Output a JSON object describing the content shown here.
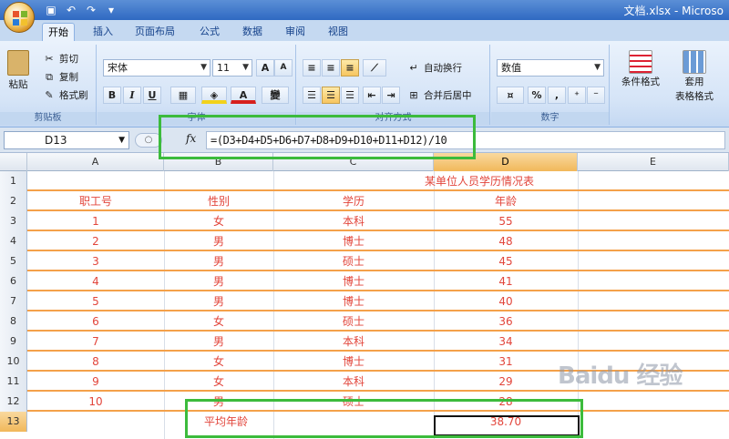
{
  "window": {
    "title": "文档.xlsx - Microso"
  },
  "tabs": [
    "开始",
    "插入",
    "页面布局",
    "公式",
    "数据",
    "审阅",
    "视图"
  ],
  "ribbon": {
    "clipboard": {
      "paste": "粘贴",
      "cut": "剪切",
      "copy": "复制",
      "format_painter": "格式刷",
      "label": "剪贴板"
    },
    "font": {
      "name": "宋体",
      "size": "11",
      "grow": "A",
      "shrink": "A",
      "bold": "B",
      "italic": "I",
      "underline": "U",
      "font_color": "A",
      "label": "字体"
    },
    "alignment": {
      "wrap": "自动换行",
      "merge": "合并后居中",
      "label": "对齐方式"
    },
    "number": {
      "format": "数值",
      "percent": "%",
      "comma": ",",
      "label": "数字"
    },
    "styles": {
      "conditional": "条件格式",
      "table_format_1": "套用",
      "table_format_2": "表格格式"
    }
  },
  "formula_bar": {
    "name_box": "D13",
    "fx": "fx",
    "formula": "=(D3+D4+D5+D6+D7+D8+D9+D10+D11+D12)/10"
  },
  "columns": [
    "A",
    "B",
    "C",
    "D",
    "E"
  ],
  "sheet": {
    "title": "某单位人员学历情况表",
    "headers": [
      "职工号",
      "性别",
      "学历",
      "年龄"
    ],
    "rows": [
      [
        "1",
        "女",
        "本科",
        "55"
      ],
      [
        "2",
        "男",
        "博士",
        "48"
      ],
      [
        "3",
        "男",
        "硕士",
        "45"
      ],
      [
        "4",
        "男",
        "博士",
        "41"
      ],
      [
        "5",
        "男",
        "博士",
        "40"
      ],
      [
        "6",
        "女",
        "硕士",
        "36"
      ],
      [
        "7",
        "男",
        "本科",
        "34"
      ],
      [
        "8",
        "女",
        "博士",
        "31"
      ],
      [
        "9",
        "女",
        "本科",
        "29"
      ],
      [
        "10",
        "男",
        "硕士",
        "28"
      ]
    ],
    "avg_label": "平均年龄",
    "avg_value": "38.70"
  },
  "row_numbers": [
    "1",
    "2",
    "3",
    "4",
    "5",
    "6",
    "7",
    "8",
    "9",
    "10",
    "11",
    "12",
    "13"
  ],
  "watermark": "Baidu 经验",
  "colors": {
    "accent": "#2f69c2",
    "cell_text": "#e2453b",
    "row_border": "#f4a14a",
    "highlight_box": "#3cbb3c"
  }
}
